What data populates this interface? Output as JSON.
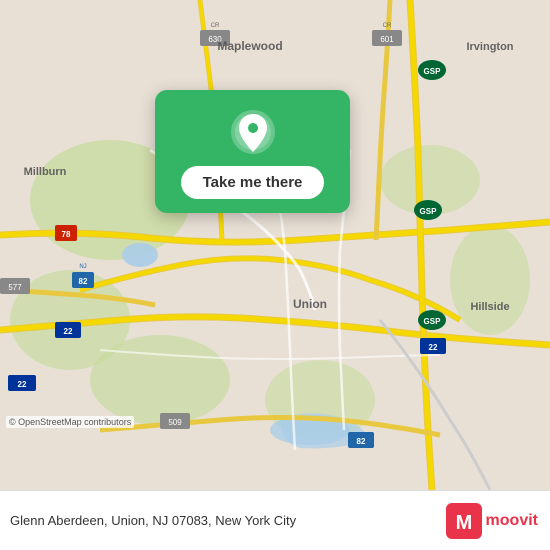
{
  "map": {
    "alt": "Map of Glenn Aberdeen, Union, NJ 07083"
  },
  "card": {
    "button_label": "Take me there"
  },
  "bottom_bar": {
    "address": "Glenn Aberdeen, Union, NJ 07083, New York City"
  },
  "osm": {
    "credit": "© OpenStreetMap contributors"
  },
  "moovit": {
    "label": "moovit"
  }
}
